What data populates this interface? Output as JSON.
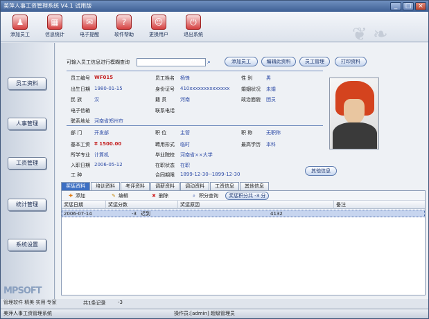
{
  "window": {
    "title": "美萍人事工资管理系统  V4.1  试用版",
    "min": "_",
    "max": "□",
    "close": "×"
  },
  "toolbar": [
    {
      "label": "添加员工",
      "icon": "person-add-icon",
      "glyph": "♟"
    },
    {
      "label": "信息统计",
      "icon": "stats-icon",
      "glyph": "▦"
    },
    {
      "label": "电子提醒",
      "icon": "alarm-icon",
      "glyph": "✉"
    },
    {
      "label": "软件帮助",
      "icon": "help-icon",
      "glyph": "?"
    },
    {
      "label": "更换用户",
      "icon": "switch-user-icon",
      "glyph": "☺"
    },
    {
      "label": "退出系统",
      "icon": "exit-icon",
      "glyph": "⏻"
    }
  ],
  "sidebar": [
    "员工资料",
    "人事管理",
    "工资管理",
    "统计管理",
    "系统设置"
  ],
  "search": {
    "label": "可输入员工信息进行模糊查询",
    "value": ""
  },
  "actions": [
    "添加员工",
    "编辑此资料",
    "员工管理",
    "打印资料"
  ],
  "fields": {
    "emp_no": {
      "label": "员工编号",
      "value": "WF015"
    },
    "name": {
      "label": "员工姓名",
      "value": "杨锋"
    },
    "gender": {
      "label": "性    别",
      "value": "男"
    },
    "birth": {
      "label": "出生日期",
      "value": "1980-01-15"
    },
    "id_card": {
      "label": "身份证号",
      "value": "410xxxxxxxxxxxxxx"
    },
    "marriage": {
      "label": "婚姻状况",
      "value": "未婚"
    },
    "ethnic": {
      "label": "民    族",
      "value": "汉"
    },
    "native": {
      "label": "籍    贯",
      "value": "河南"
    },
    "politics": {
      "label": "政治面貌",
      "value": "团员"
    },
    "email": {
      "label": "电子信箱",
      "value": ""
    },
    "phone": {
      "label": "联系电话",
      "value": ""
    },
    "address": {
      "label": "联系地址",
      "value": "河南省郑州市"
    },
    "dept": {
      "label": "部    门",
      "value": "开发部"
    },
    "post": {
      "label": "职    位",
      "value": "主管"
    },
    "title": {
      "label": "职    称",
      "value": "无职称"
    },
    "salary": {
      "label": "基本工资",
      "value": "¥ 1500.00"
    },
    "hire": {
      "label": "聘用形式",
      "value": "临时"
    },
    "edu": {
      "label": "最高学历",
      "value": "本科"
    },
    "major": {
      "label": "所学专业",
      "value": "计算机"
    },
    "school": {
      "label": "毕业院校",
      "value": "河南省××大学"
    },
    "join": {
      "label": "入职日期",
      "value": "2006-05-12"
    },
    "status": {
      "label": "在职状态",
      "value": "在职"
    },
    "type": {
      "label": "工    种",
      "value": ""
    },
    "contract": {
      "label": "合同期限",
      "value": "1899-12-30--1899-12-30"
    }
  },
  "more_info": "其他信息",
  "tabs": [
    "奖惩资料",
    "培训资料",
    "考评资料",
    "调薪资料",
    "调动资料",
    "工资信息",
    "其他信息"
  ],
  "panel_tools": [
    {
      "label": "添加",
      "icon": "add-icon",
      "glyph": "✚",
      "color": "#e07b12"
    },
    {
      "label": "编辑",
      "icon": "pencil-icon",
      "glyph": "✎",
      "color": "#c58a10"
    },
    {
      "label": "删除",
      "icon": "delete-icon",
      "glyph": "✖",
      "color": "#d02020"
    },
    {
      "label": "积分查询",
      "icon": "search-icon",
      "glyph": "⌕",
      "color": "#2c4aa6"
    }
  ],
  "points_total": "奖惩积分共 -3 分",
  "grid": {
    "headers": [
      "奖惩日期",
      "奖惩分数",
      "奖惩原因",
      "备注"
    ],
    "rows": [
      [
        "2006-07-14",
        "-3",
        "迟到",
        "4132"
      ]
    ]
  },
  "total": {
    "label": "共1条记录",
    "value": "-3"
  },
  "status": {
    "left": "美萍人事工资管理系统",
    "operator": "操作员:[admin] 超级管理员"
  },
  "logo": {
    "text": "MPSOFT",
    "sub": "管理软件  精美·实用·专家"
  },
  "colors": {
    "accent": "#3c6fc3",
    "value": "#2c4aa6",
    "alert": "#c42020"
  }
}
